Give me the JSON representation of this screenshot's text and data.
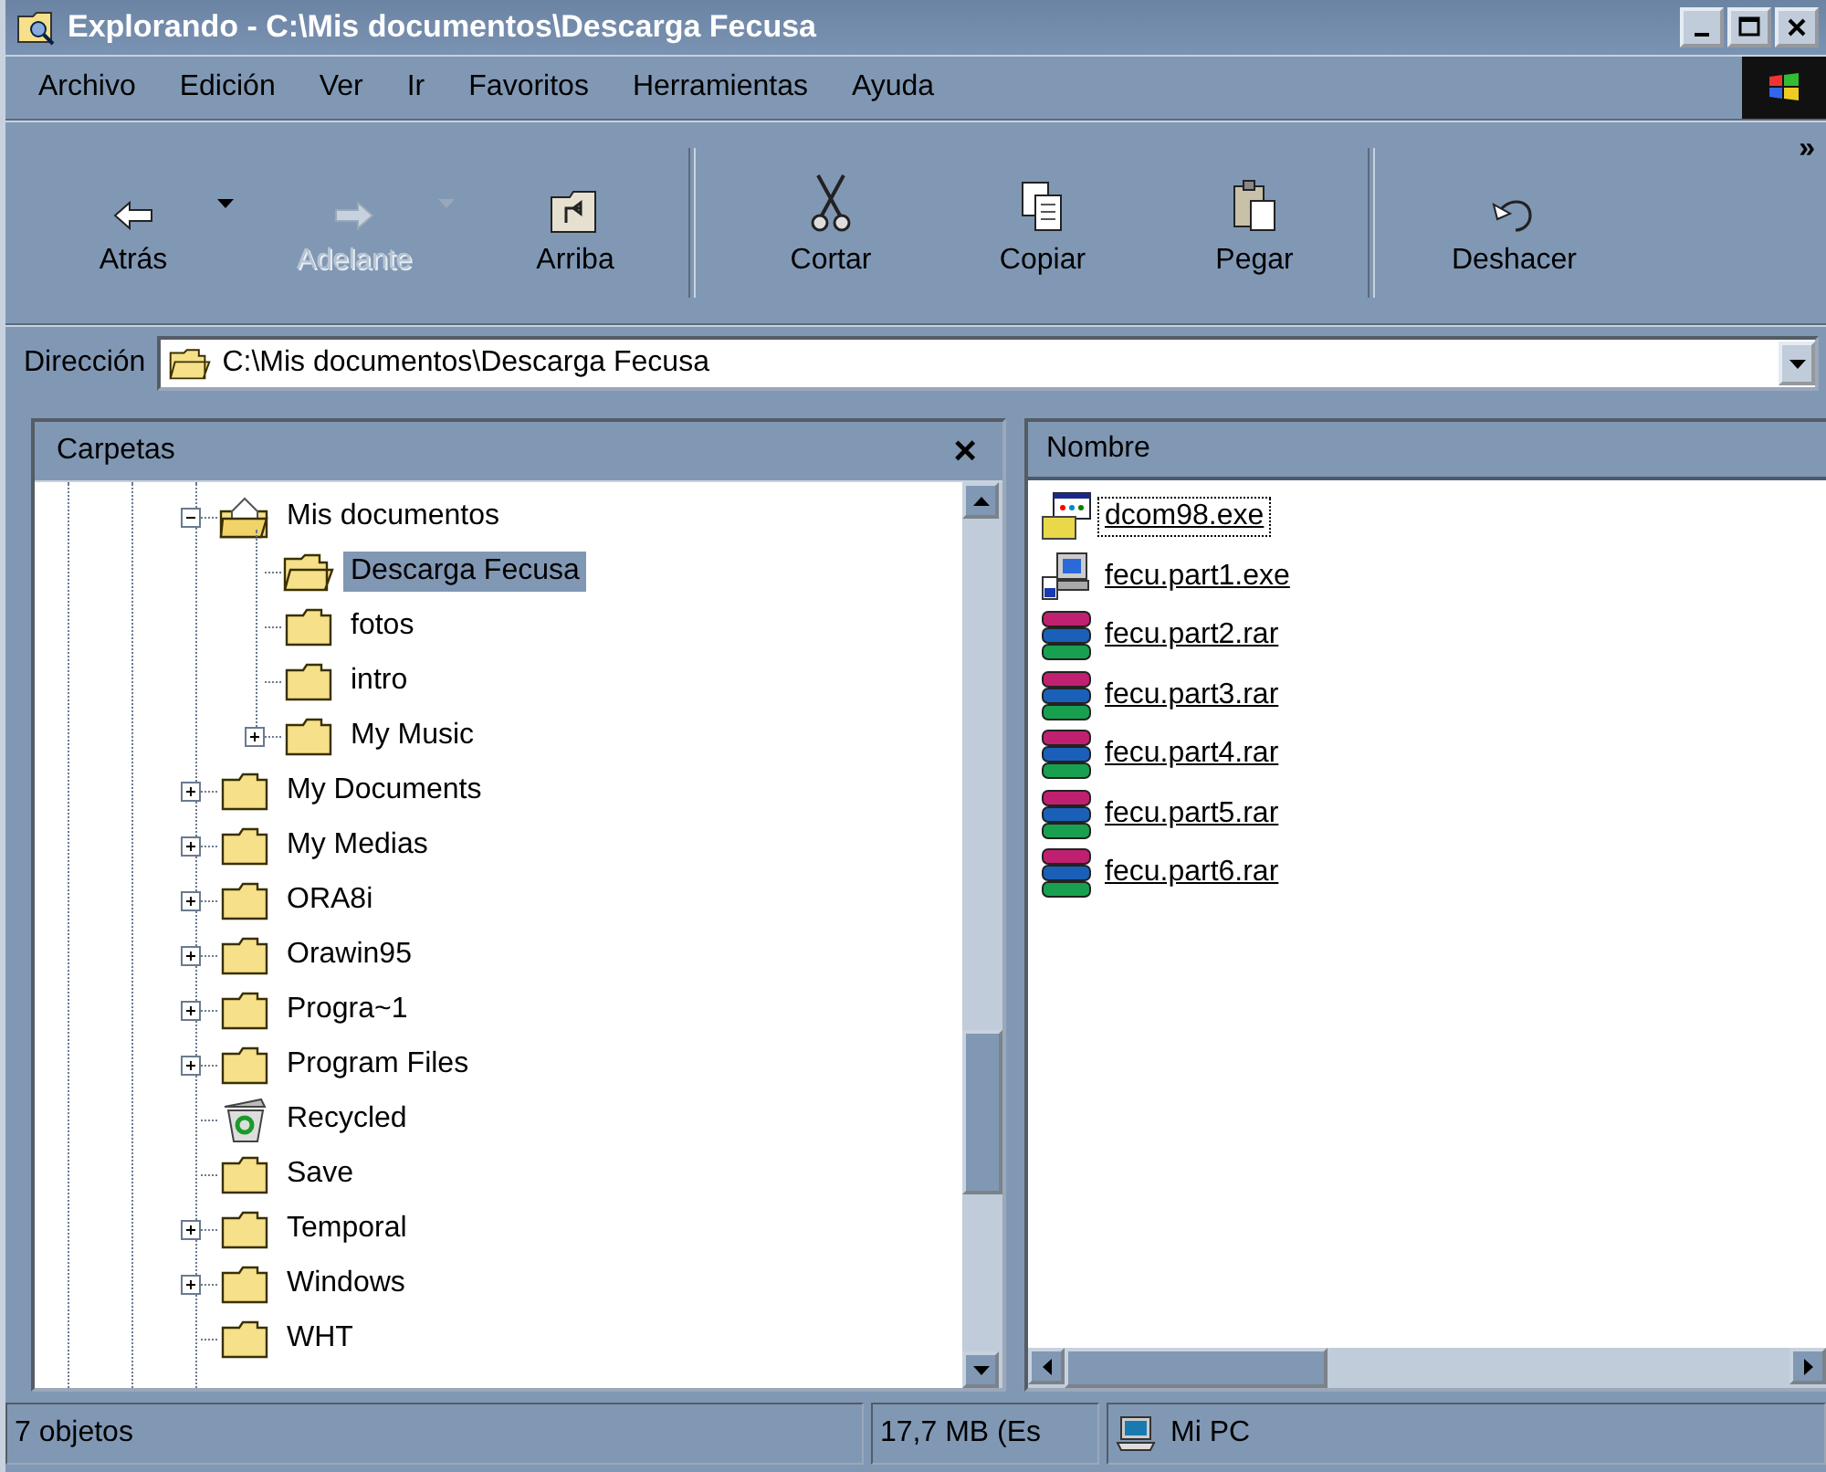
{
  "window": {
    "title": "Explorando - C:\\Mis documentos\\Descarga Fecusa"
  },
  "menu": [
    "Archivo",
    "Edición",
    "Ver",
    "Ir",
    "Favoritos",
    "Herramientas",
    "Ayuda"
  ],
  "toolbar": [
    {
      "items": [
        {
          "kind": "back",
          "label": "Atrás",
          "disabled": false,
          "dropdown": true
        },
        {
          "kind": "forward",
          "label": "Adelante",
          "disabled": true,
          "dropdown": true
        },
        {
          "kind": "up",
          "label": "Arriba",
          "disabled": false,
          "dropdown": false
        }
      ]
    },
    {
      "items": [
        {
          "kind": "cut",
          "label": "Cortar",
          "disabled": false,
          "dropdown": false
        },
        {
          "kind": "copy",
          "label": "Copiar",
          "disabled": false,
          "dropdown": false
        },
        {
          "kind": "paste",
          "label": "Pegar",
          "disabled": false,
          "dropdown": false
        }
      ]
    },
    {
      "items": [
        {
          "kind": "undo",
          "label": "Deshacer",
          "disabled": false,
          "dropdown": false
        }
      ]
    }
  ],
  "toolbar_more": "»",
  "address": {
    "label": "Dirección",
    "value": "C:\\Mis documentos\\Descarga Fecusa"
  },
  "folders_pane": {
    "title": "Carpetas",
    "close": "×"
  },
  "tree": [
    {
      "label": "Mis documentos",
      "kind": "home-folder",
      "expandable": true,
      "expanded": true,
      "selected": false,
      "children": [
        {
          "label": "Descarga Fecusa",
          "kind": "open-folder",
          "expandable": false,
          "selected": true
        },
        {
          "label": "fotos",
          "kind": "folder",
          "expandable": false,
          "selected": false
        },
        {
          "label": "intro",
          "kind": "folder",
          "expandable": false,
          "selected": false
        },
        {
          "label": "My Music",
          "kind": "folder",
          "expandable": true,
          "expanded": false,
          "selected": false
        }
      ]
    },
    {
      "label": "My Documents",
      "kind": "folder",
      "expandable": true,
      "expanded": false,
      "selected": false
    },
    {
      "label": "My Medias",
      "kind": "folder",
      "expandable": true,
      "expanded": false,
      "selected": false
    },
    {
      "label": "ORA8i",
      "kind": "folder",
      "expandable": true,
      "expanded": false,
      "selected": false
    },
    {
      "label": "Orawin95",
      "kind": "folder",
      "expandable": true,
      "expanded": false,
      "selected": false
    },
    {
      "label": "Progra~1",
      "kind": "folder",
      "expandable": true,
      "expanded": false,
      "selected": false
    },
    {
      "label": "Program Files",
      "kind": "folder",
      "expandable": true,
      "expanded": false,
      "selected": false
    },
    {
      "label": "Recycled",
      "kind": "recycle-bin",
      "expandable": false,
      "selected": false
    },
    {
      "label": "Save",
      "kind": "folder",
      "expandable": false,
      "selected": false
    },
    {
      "label": "Temporal",
      "kind": "folder",
      "expandable": true,
      "expanded": false,
      "selected": false
    },
    {
      "label": "Windows",
      "kind": "folder",
      "expandable": true,
      "expanded": false,
      "selected": false
    },
    {
      "label": "WHT",
      "kind": "folder",
      "expandable": false,
      "selected": false
    }
  ],
  "files": {
    "column": "Nombre",
    "items": [
      {
        "name": "dcom98.exe",
        "kind": "installer",
        "focused": true
      },
      {
        "name": "fecu.part1.exe",
        "kind": "setup",
        "focused": false
      },
      {
        "name": "fecu.part2.rar",
        "kind": "rar",
        "focused": false
      },
      {
        "name": "fecu.part3.rar",
        "kind": "rar",
        "focused": false
      },
      {
        "name": "fecu.part4.rar",
        "kind": "rar",
        "focused": false
      },
      {
        "name": "fecu.part5.rar",
        "kind": "rar",
        "focused": false
      },
      {
        "name": "fecu.part6.rar",
        "kind": "rar",
        "focused": false
      }
    ]
  },
  "status_bar": {
    "objects": "7 objetos",
    "size": "17,7 MB (Es",
    "zone": "Mi PC"
  }
}
